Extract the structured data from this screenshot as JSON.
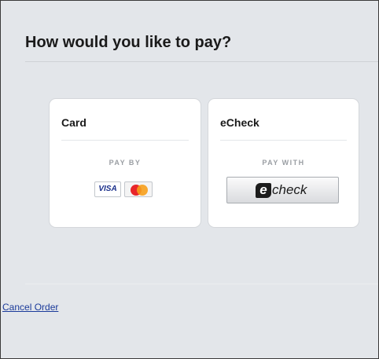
{
  "page": {
    "title": "How would you like to pay?"
  },
  "card_option": {
    "title": "Card",
    "sublabel": "PAY BY",
    "visa_label": "VISA",
    "mastercard_icon": "mastercard-logo"
  },
  "echeck_option": {
    "title": "eCheck",
    "sublabel": "PAY WITH",
    "button_letter": "e",
    "button_text": "check"
  },
  "footer": {
    "cancel_label": "Cancel Order"
  },
  "colors": {
    "background": "#e3e6ea",
    "card_background": "#ffffff",
    "link": "#1a3a9a",
    "visa_blue": "#1a2f8a",
    "mastercard_red": "#e8262b",
    "mastercard_orange": "#f7a01c"
  }
}
